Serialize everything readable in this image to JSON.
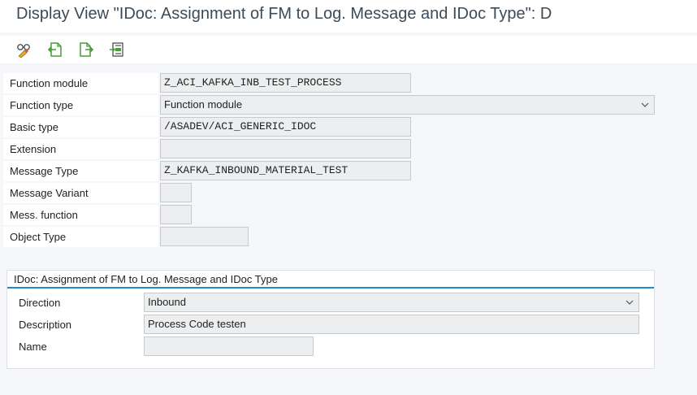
{
  "window": {
    "title": "Display View \"IDoc: Assignment of FM to Log. Message and IDoc Type\": D"
  },
  "toolbar": {
    "icons": [
      "glasses-icon",
      "previous-entry-icon",
      "next-entry-icon",
      "select-block-icon"
    ]
  },
  "form": {
    "function_module": {
      "label": "Function module",
      "value": "Z_ACI_KAFKA_INB_TEST_PROCESS"
    },
    "function_type": {
      "label": "Function type",
      "value": "Function module"
    },
    "basic_type": {
      "label": "Basic type",
      "value": "/ASADEV/ACI_GENERIC_IDOC"
    },
    "extension": {
      "label": "Extension",
      "value": ""
    },
    "message_type": {
      "label": "Message Type",
      "value": "Z_KAFKA_INBOUND_MATERIAL_TEST"
    },
    "message_variant": {
      "label": "Message Variant",
      "value": ""
    },
    "mess_function": {
      "label": "Mess. function",
      "value": ""
    },
    "object_type": {
      "label": "Object Type",
      "value": ""
    }
  },
  "group": {
    "title": "IDoc: Assignment of FM to Log. Message and IDoc Type",
    "direction": {
      "label": "Direction",
      "value": "Inbound"
    },
    "description": {
      "label": "Description",
      "value": "Process Code testen"
    },
    "name": {
      "label": "Name",
      "value": ""
    }
  },
  "colors": {
    "accent": "#1a8ed1",
    "field_bg": "#eceeef",
    "title_text": "#3d4b57"
  }
}
